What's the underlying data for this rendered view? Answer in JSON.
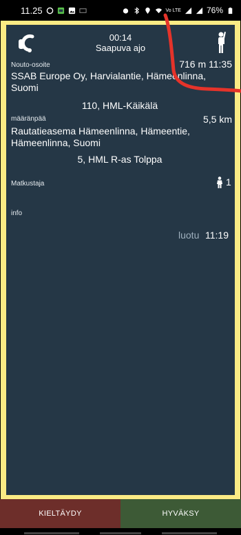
{
  "status_bar": {
    "time": "11.25",
    "battery": "76%",
    "network": "Vo LTE"
  },
  "header": {
    "timer": "00:14",
    "title": "Saapuva ajo"
  },
  "pickup": {
    "label": "Nouto-osoite",
    "distance_time": "716 m 11:35",
    "address": "SSAB Europe Oy, Harvialantie, Hämeenlinna, Suomi",
    "stop": "110, HML-Käikälä"
  },
  "destination": {
    "label": "määränpää",
    "distance": "5,5 km",
    "address": "Rautatieasema Hämeenlinna, Hämeentie, Hämeenlinna, Suomi",
    "stop": "5, HML R-as Tolppa"
  },
  "passengers": {
    "label": "Matkustaja",
    "count": "1"
  },
  "info": {
    "label": "info"
  },
  "created": {
    "label": "luotu",
    "time": "11:19"
  },
  "actions": {
    "reject_label": "KIELTÄYDY",
    "accept_label": "HYVÄKSY"
  },
  "colors": {
    "panel": "#253746",
    "frame": "#fbeb84",
    "reject": "#6d2e2a",
    "accept": "#3d5a36",
    "annotation": "#e5332a"
  }
}
